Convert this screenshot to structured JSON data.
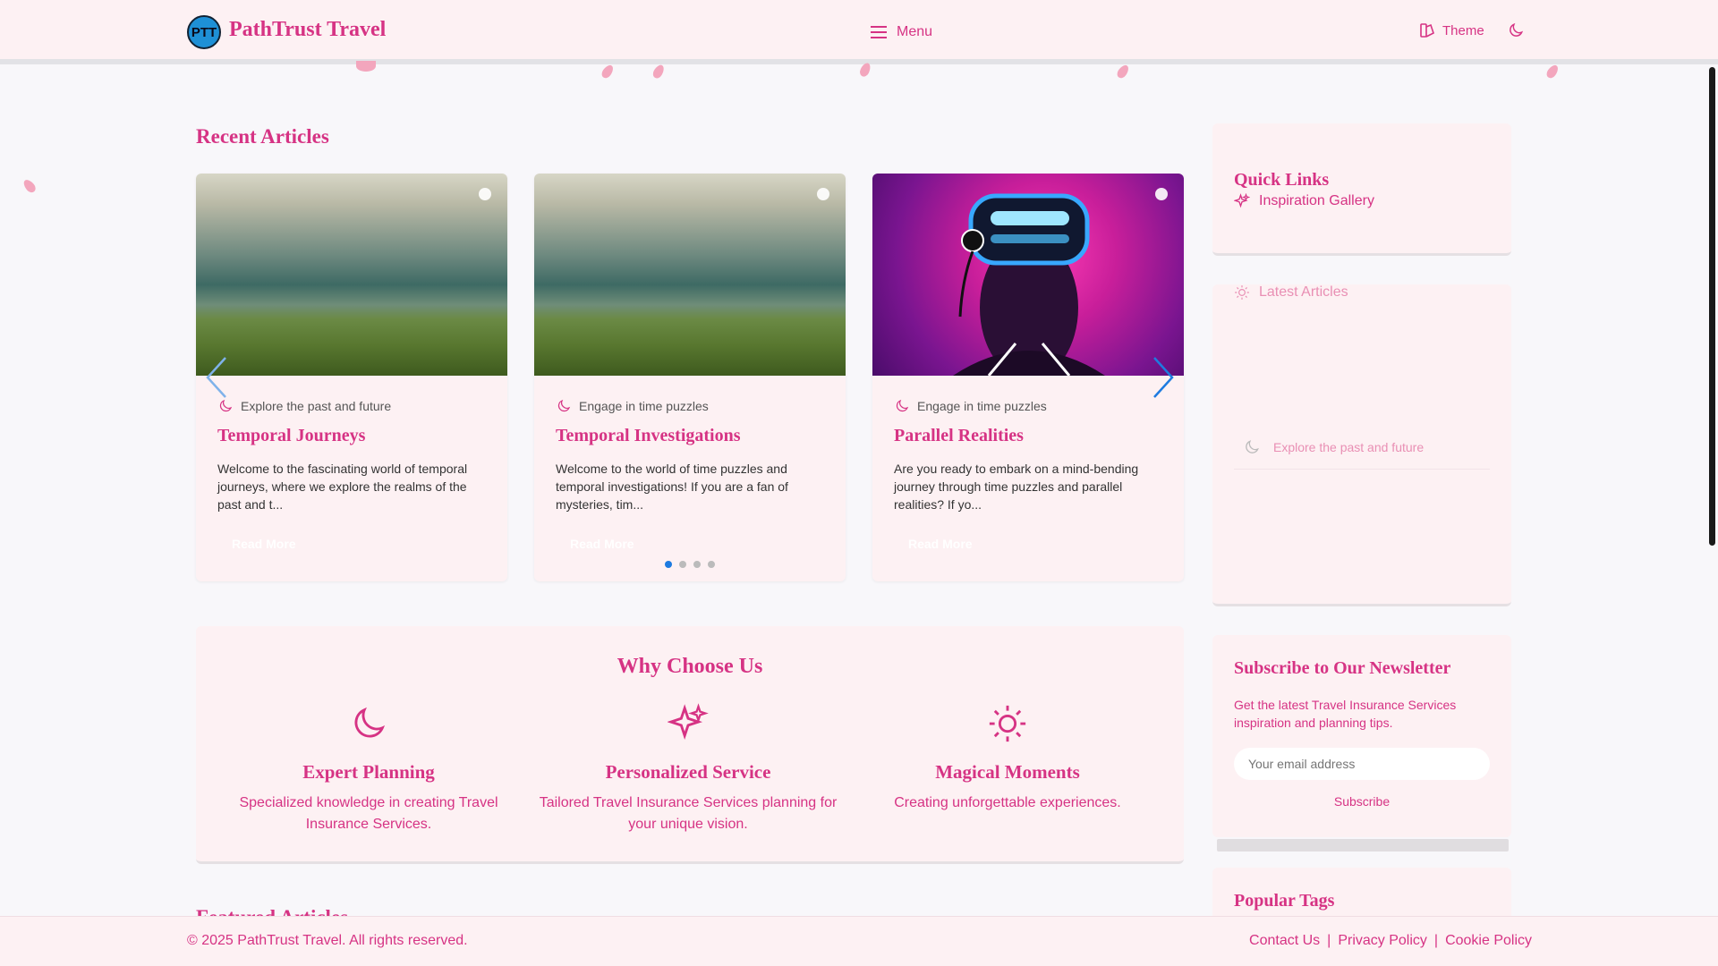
{
  "header": {
    "logo_text": "PTT",
    "brand": "PathTrust Travel",
    "menu_label": "Menu",
    "theme_label": "Theme"
  },
  "recent": {
    "title": "Recent Articles",
    "cards": [
      {
        "category": "Explore the past and future",
        "title": "Temporal Journeys",
        "text": "Welcome to the fascinating world of temporal journeys, where we explore the realms of the past and t...",
        "read": "Read More"
      },
      {
        "category": "Engage in time puzzles",
        "title": "Temporal Investigations",
        "text": "Welcome to the world of time puzzles and temporal investigations! If you are a fan of mysteries, tim...",
        "read": "Read More"
      },
      {
        "category": "Engage in time puzzles",
        "title": "Parallel Realities",
        "text": "Are you ready to embark on a mind-bending journey through time puzzles and parallel realities? If yo...",
        "read": "Read More"
      }
    ]
  },
  "why": {
    "title": "Why Choose Us",
    "features": [
      {
        "title": "Expert Planning",
        "text": "Specialized knowledge in creating Travel Insurance Services."
      },
      {
        "title": "Personalized Service",
        "text": "Tailored Travel Insurance Services planning for your unique vision."
      },
      {
        "title": "Magical Moments",
        "text": "Creating unforgettable experiences."
      }
    ]
  },
  "featured_title_partial": "Featured Articles",
  "sidebar": {
    "quick_links_title": "Quick Links",
    "quick_link_1": "Inspiration Gallery",
    "latest_title": "Latest Articles",
    "latest_item": "Explore the past and future",
    "newsletter_title": "Subscribe to Our Newsletter",
    "newsletter_text": "Get the latest Travel Insurance Services inspiration and planning tips.",
    "newsletter_placeholder": "Your email address",
    "subscribe_label": "Subscribe",
    "tags_title": "Popular Tags"
  },
  "footer": {
    "copyright": "© 2025 PathTrust Travel. All rights reserved.",
    "links": [
      "Contact Us",
      "Privacy Policy",
      "Cookie Policy"
    ],
    "separator": "|"
  },
  "colors": {
    "accent": "#d63384",
    "bg": "#fdf1f3"
  }
}
